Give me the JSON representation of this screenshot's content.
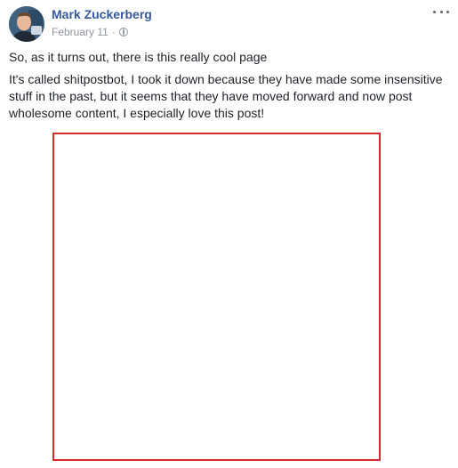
{
  "post": {
    "author": "Mark Zuckerberg",
    "date": "February 11",
    "separator": "·",
    "privacy_icon": "globe-icon",
    "paragraphs": [
      "So, as it turns out, there is this really cool page",
      "It's called shitpostbot, I took it down because they have made some insensitive stuff in the past, but it seems that they have moved forward and now post wholesome content, I especially love this post!"
    ],
    "image_border_color": "#d62b2b",
    "author_color": "#365899"
  }
}
